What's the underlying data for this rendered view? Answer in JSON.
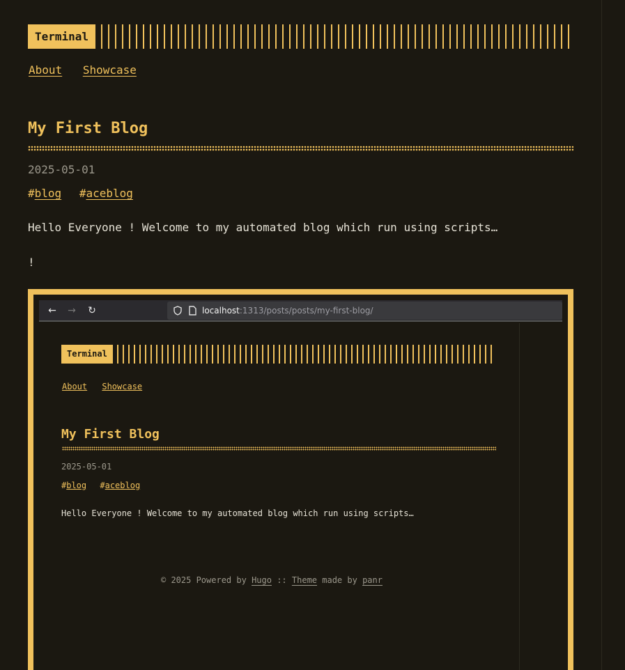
{
  "header": {
    "logo": "Terminal"
  },
  "nav": {
    "items": [
      "About",
      "Showcase"
    ]
  },
  "post": {
    "title": "My First Blog",
    "date": "2025-05-01",
    "tags": [
      "blog",
      "aceblog"
    ],
    "intro": "Hello Everyone ! Welcome to my automated blog which run using scripts…",
    "line2": "!"
  },
  "screenshot": {
    "browser": {
      "url_host": "localhost",
      "url_rest": ":1313/posts/posts/my-first-blog/"
    },
    "header": {
      "logo": "Terminal"
    },
    "nav": {
      "items": [
        "About",
        "Showcase"
      ]
    },
    "post": {
      "title": "My First Blog",
      "date": "2025-05-01",
      "tags": [
        "blog",
        "aceblog"
      ],
      "intro": "Hello Everyone ! Welcome to my automated blog which run using scripts…"
    },
    "footer": {
      "prefix": "© 2025 Powered by",
      "hugo": "Hugo",
      "sep": "::",
      "theme": "Theme",
      "made_by": "made by",
      "author": "panr"
    }
  },
  "colors": {
    "accent": "#f0c15c",
    "background": "#1b1811",
    "text": "#e6e2d6",
    "muted": "#9c988c"
  }
}
